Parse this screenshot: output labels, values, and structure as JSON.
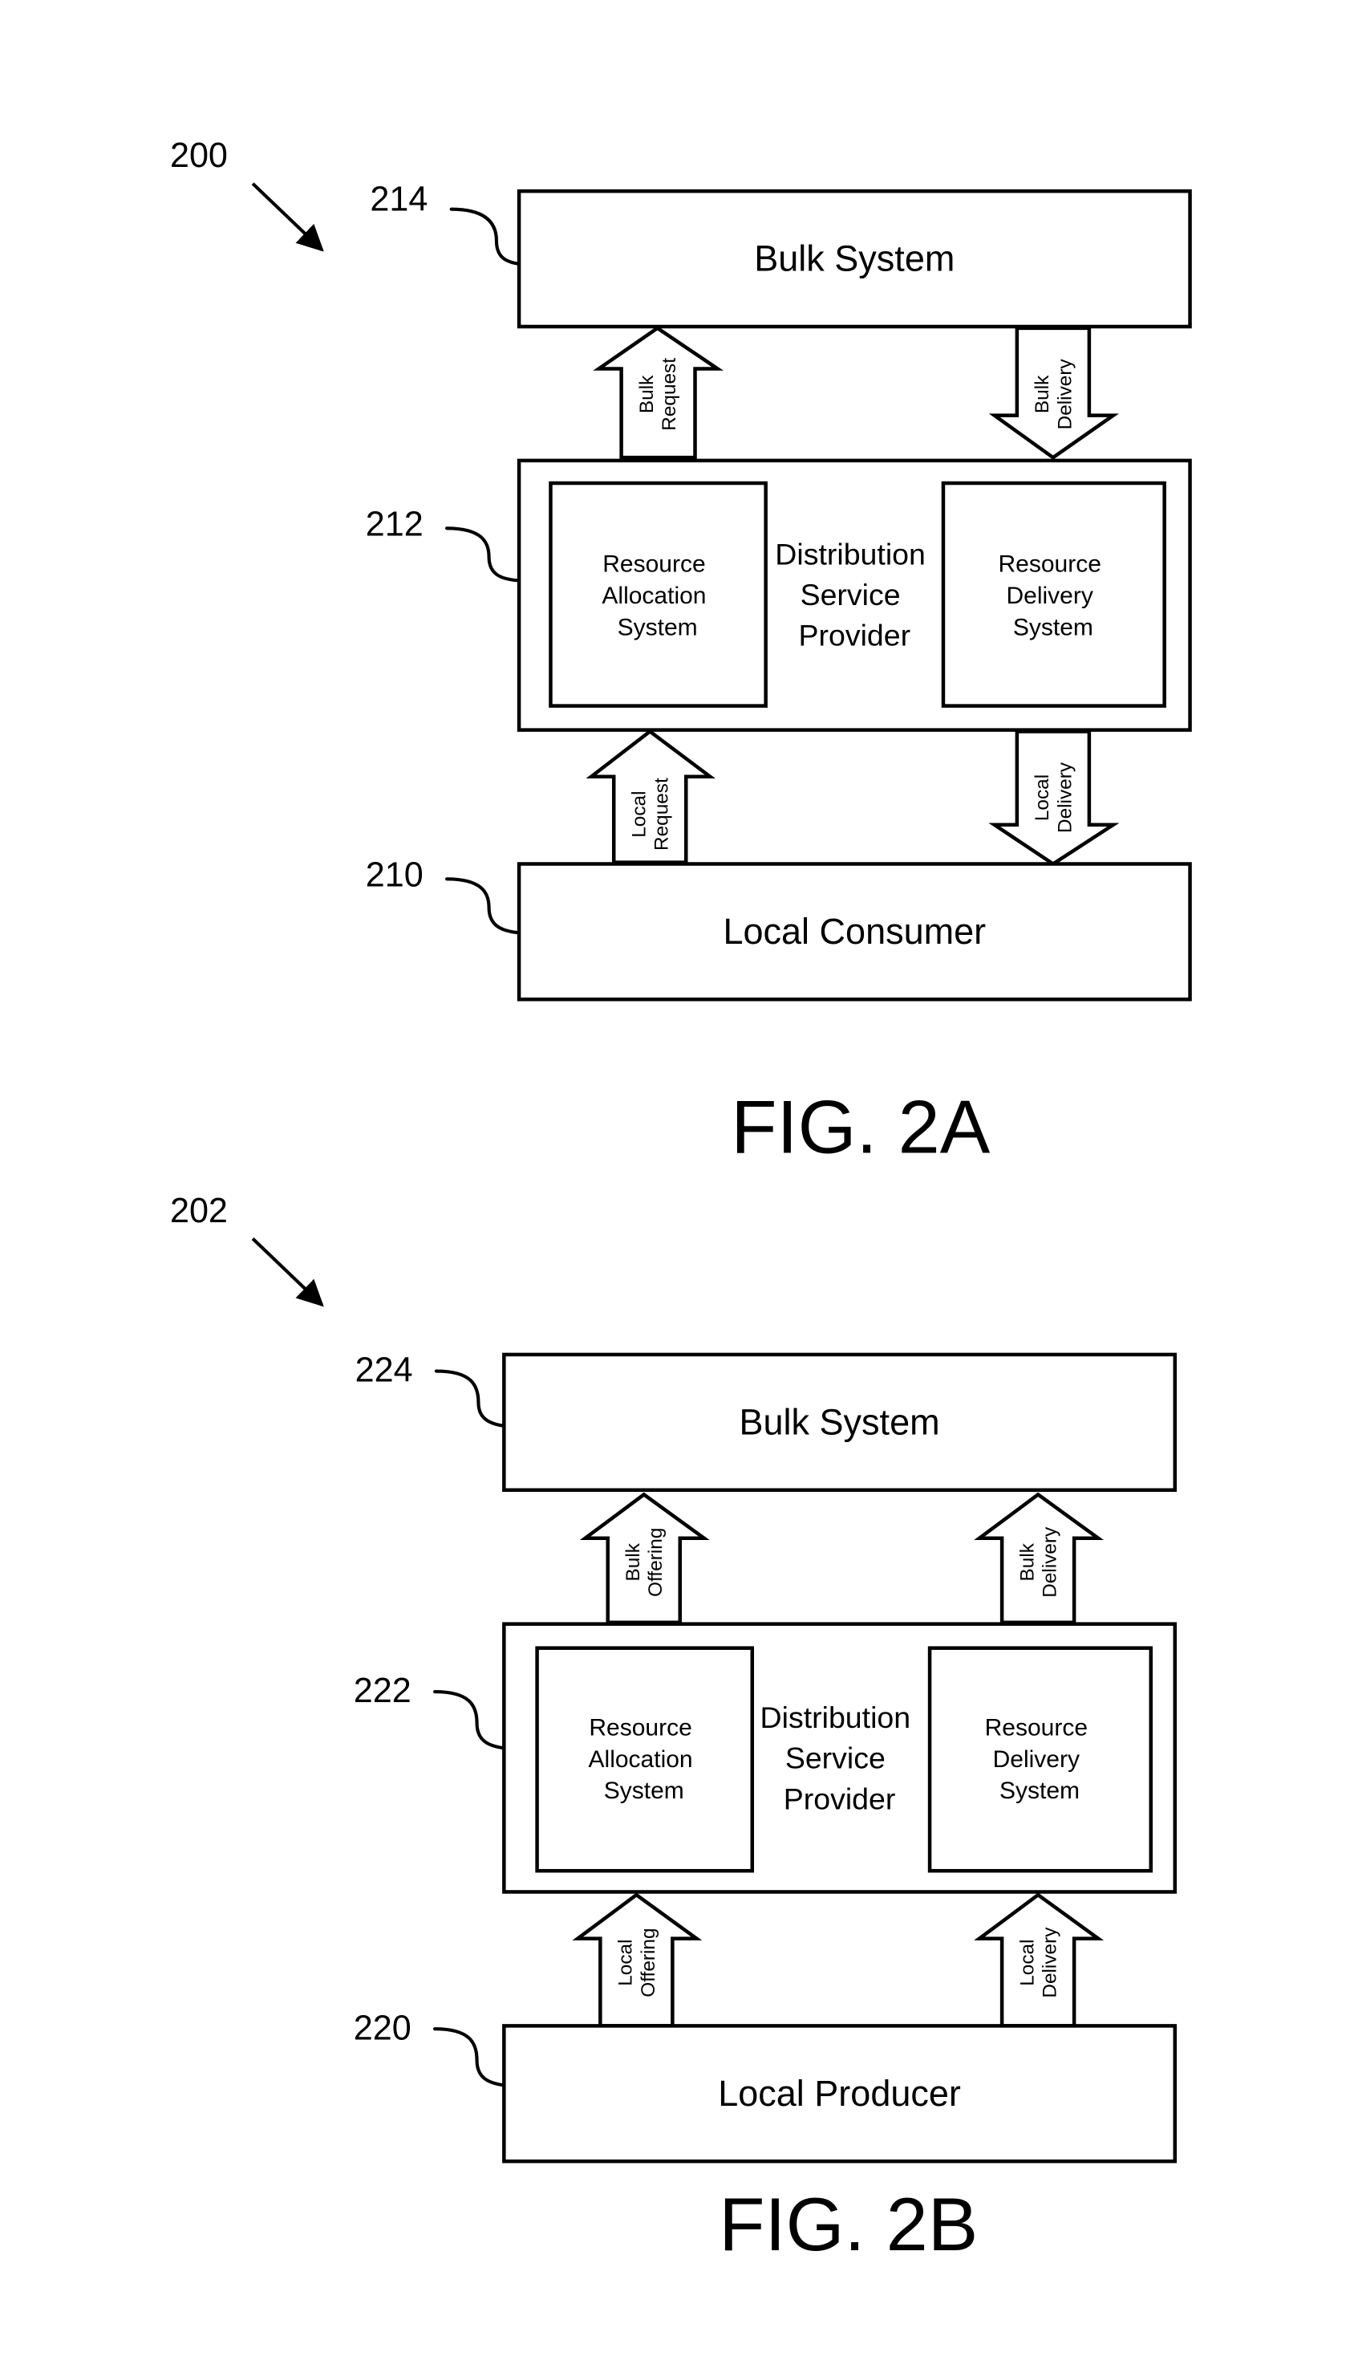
{
  "colors": {
    "stroke": "#000000",
    "background": "#ffffff"
  },
  "figures": [
    {
      "id": "2A",
      "caption": "FIG. 2A",
      "ref": "200",
      "top": {
        "ref": "214",
        "label": "Bulk System"
      },
      "middle": {
        "ref": "212",
        "label_lines": [
          "Distribution",
          "Service",
          "Provider"
        ],
        "left": {
          "label_lines": [
            "Resource",
            "Allocation",
            "System"
          ]
        },
        "right": {
          "label_lines": [
            "Resource",
            "Delivery",
            "System"
          ]
        }
      },
      "bottom": {
        "ref": "210",
        "label": "Local Consumer"
      },
      "arrows": [
        {
          "lines": [
            "Bulk",
            "Request"
          ],
          "direction": "up"
        },
        {
          "lines": [
            "Bulk",
            "Delivery"
          ],
          "direction": "down"
        },
        {
          "lines": [
            "Local",
            "Request"
          ],
          "direction": "up"
        },
        {
          "lines": [
            "Local",
            "Delivery"
          ],
          "direction": "down"
        }
      ]
    },
    {
      "id": "2B",
      "caption": "FIG. 2B",
      "ref": "202",
      "top": {
        "ref": "224",
        "label": "Bulk System"
      },
      "middle": {
        "ref": "222",
        "label_lines": [
          "Distribution",
          "Service",
          "Provider"
        ],
        "left": {
          "label_lines": [
            "Resource",
            "Allocation",
            "System"
          ]
        },
        "right": {
          "label_lines": [
            "Resource",
            "Delivery",
            "System"
          ]
        }
      },
      "bottom": {
        "ref": "220",
        "label": "Local Producer"
      },
      "arrows": [
        {
          "lines": [
            "Bulk",
            "Offering"
          ],
          "direction": "up"
        },
        {
          "lines": [
            "Bulk",
            "Delivery"
          ],
          "direction": "up"
        },
        {
          "lines": [
            "Local",
            "Offering"
          ],
          "direction": "up"
        },
        {
          "lines": [
            "Local",
            "Delivery"
          ],
          "direction": "up"
        }
      ]
    }
  ]
}
